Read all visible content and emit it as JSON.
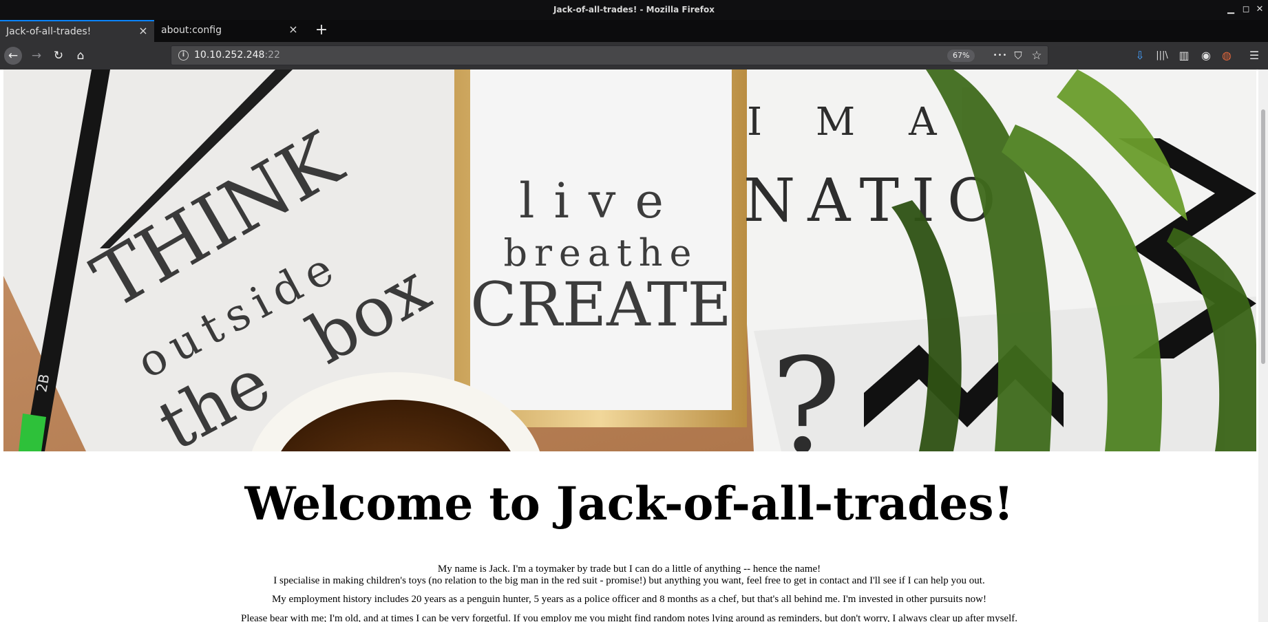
{
  "window": {
    "title": "Jack-of-all-trades! - Mozilla Firefox",
    "controls": {
      "minimize": "▁",
      "maximize": "◻",
      "close": "✕"
    }
  },
  "tabs": [
    {
      "label": "Jack-of-all-trades!",
      "active": true
    },
    {
      "label": "about:config",
      "active": false
    }
  ],
  "toolbar": {
    "new_tab": "+",
    "back": "←",
    "forward": "→",
    "reload": "↻",
    "home": "⌂",
    "info": "i"
  },
  "urlbar": {
    "host": "10.10.252.248",
    "port": ":22",
    "zoom": "67%",
    "page_actions": "•••",
    "pocket": "⛉",
    "bookmark": "☆"
  },
  "right_toolbar": {
    "downloads": "⇩",
    "library": "|||\\",
    "sidebar": "▥",
    "account": "◉",
    "extension": "◍",
    "menu": "☰"
  },
  "hero": {
    "sign1": [
      "THINK",
      "outside",
      "the",
      "box"
    ],
    "sign2": [
      "live",
      "breathe",
      "CREATE"
    ],
    "sign3": [
      "I M A",
      "NATIO"
    ],
    "pencil": "2B",
    "question": "?"
  },
  "page": {
    "heading": "Welcome to Jack-of-all-trades!",
    "line1": "My name is Jack. I'm a toymaker by trade but I can do a little of anything -- hence the name!",
    "line2": "I specialise in making children's toys (no relation to the big man in the red suit - promise!) but anything you want, feel free to get in contact and I'll see if I can help you out.",
    "line3": "My employment history includes 20 years as a penguin hunter, 5 years as a police officer and 8 months as a chef, but that's all behind me. I'm invested in other pursuits now!",
    "line4": "Please bear with me; I'm old, and at times I can be very forgetful. If you employ me you might find random notes lying around as reminders, but don't worry, I always clear up after myself."
  },
  "colors": {
    "accent": "#0a84ff",
    "chrome_dark": "#0c0c0d",
    "toolbar": "#323234"
  }
}
